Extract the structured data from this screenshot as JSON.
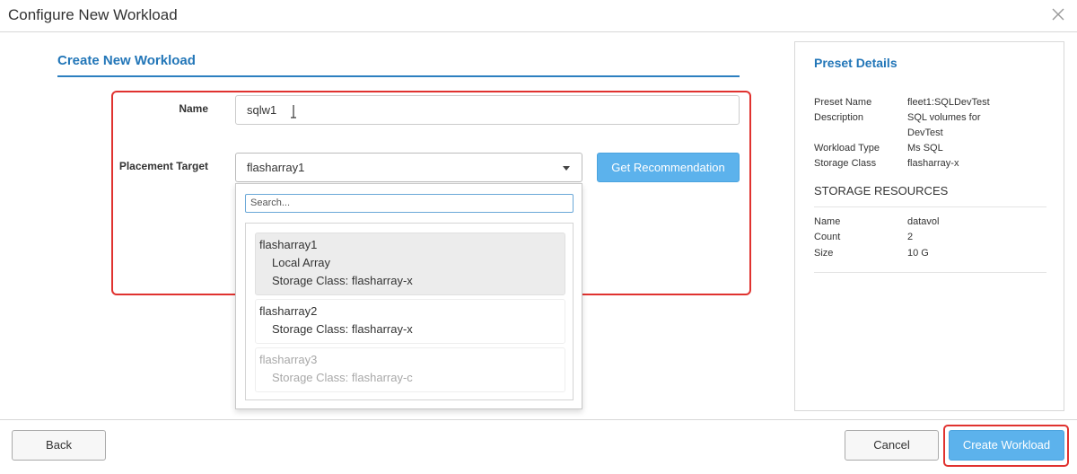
{
  "window": {
    "title": "Configure New Workload"
  },
  "form": {
    "section_title": "Create New Workload",
    "name_label": "Name",
    "name_value": "sqlw1",
    "target_label": "Placement Target",
    "target_value": "flasharray1",
    "recommend_label": "Get Recommendation"
  },
  "dropdown": {
    "search_placeholder": "Search...",
    "options": [
      {
        "name": "flasharray1",
        "detail1": "Local Array",
        "detail2": "Storage Class: flasharray-x",
        "state": "highlighted"
      },
      {
        "name": "flasharray2",
        "detail1": "Storage Class: flasharray-x",
        "state": "normal"
      },
      {
        "name": "flasharray3",
        "detail1": "Storage Class: flasharray-c",
        "state": "disabled"
      }
    ]
  },
  "preset": {
    "title": "Preset Details",
    "fields": [
      {
        "key": "Preset Name",
        "value": "fleet1:SQLDevTest"
      },
      {
        "key": "Description",
        "value": "SQL volumes for DevTest"
      },
      {
        "key": "Workload Type",
        "value": "Ms SQL"
      },
      {
        "key": "Storage Class",
        "value": "flasharray-x"
      }
    ],
    "resources_title": "STORAGE RESOURCES",
    "resources": [
      {
        "key": "Name",
        "value": "datavol"
      },
      {
        "key": "Count",
        "value": "2"
      },
      {
        "key": "Size",
        "value": "10 G"
      }
    ]
  },
  "footer": {
    "back_label": "Back",
    "cancel_label": "Cancel",
    "create_label": "Create Workload"
  },
  "colors": {
    "accent": "#2276b8",
    "primary_button": "#5cb2ec",
    "highlight_border": "#e0322f"
  }
}
